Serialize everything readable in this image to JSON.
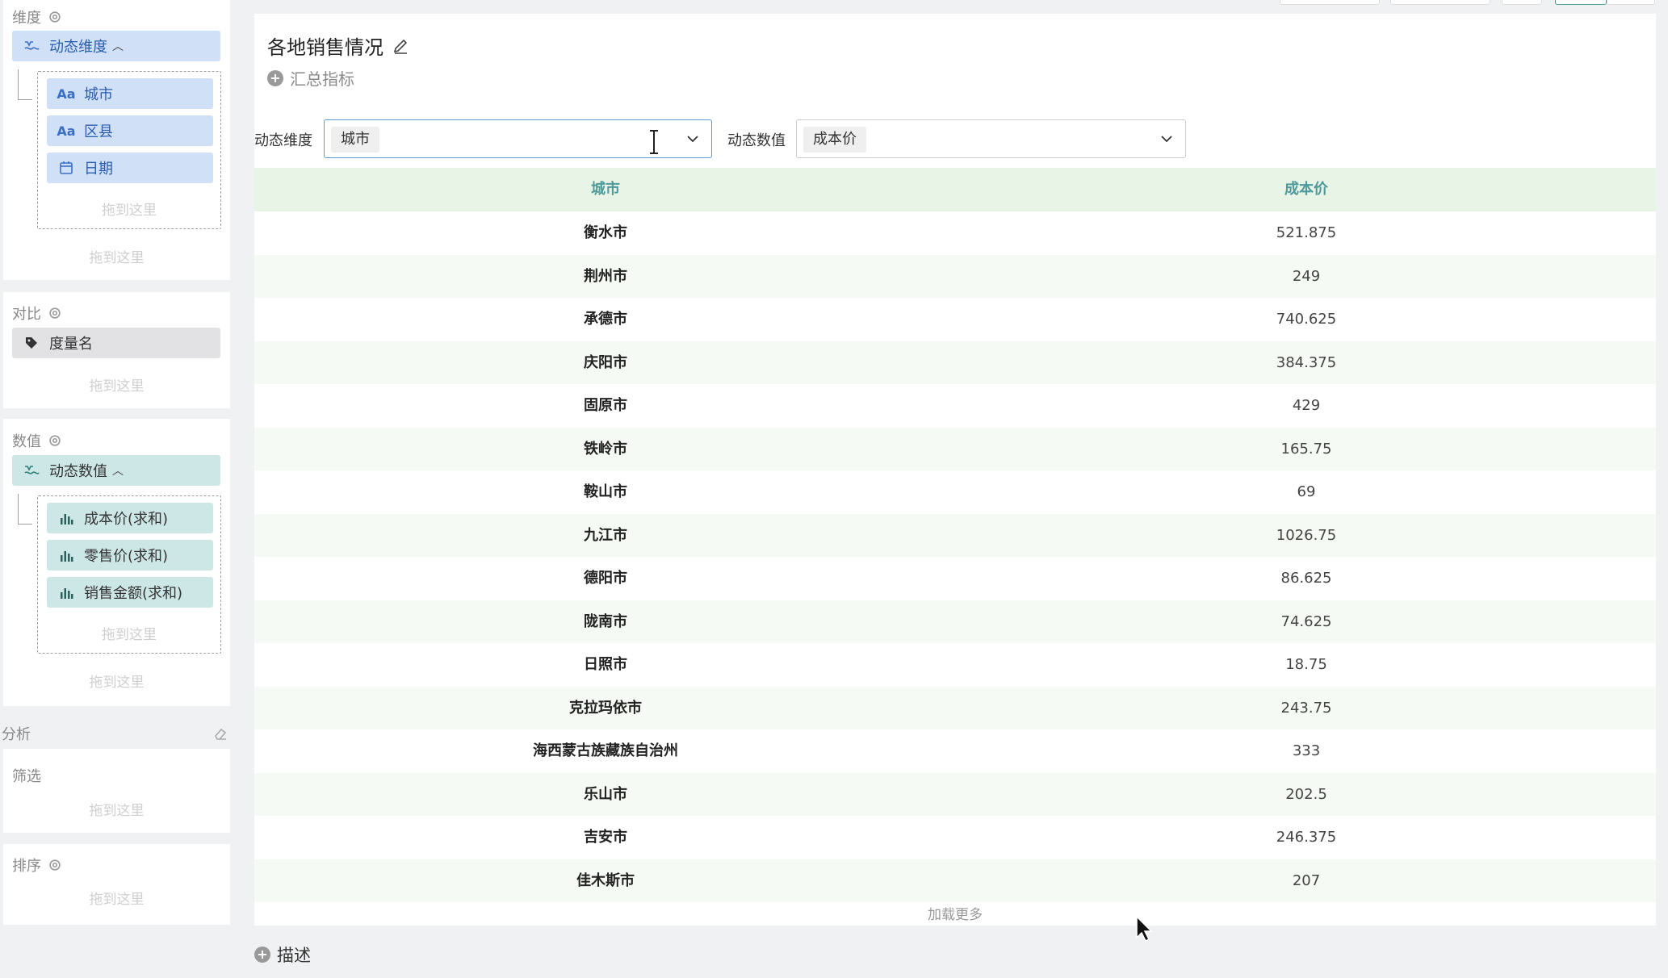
{
  "sidebar": {
    "dimension": {
      "title": "维度",
      "dynamic_label": "动态维度",
      "items": [
        {
          "label": "城市",
          "icon": "text-field-icon"
        },
        {
          "label": "区县",
          "icon": "text-field-icon"
        },
        {
          "label": "日期",
          "icon": "calendar-icon"
        }
      ],
      "drop_inner": "拖到这里",
      "drop_outer": "拖到这里"
    },
    "compare": {
      "title": "对比",
      "item": "度量名",
      "drop": "拖到这里"
    },
    "value": {
      "title": "数值",
      "dynamic_label": "动态数值",
      "items": [
        {
          "label": "成本价(求和)"
        },
        {
          "label": "零售价(求和)"
        },
        {
          "label": "销售金额(求和)"
        }
      ],
      "drop_inner": "拖到这里",
      "drop_outer": "拖到这里"
    },
    "analysis": {
      "title": "分析",
      "filter_title": "筛选",
      "filter_drop": "拖到这里",
      "sort_title": "排序",
      "sort_drop": "拖到这里"
    }
  },
  "main": {
    "title": "各地销售情况",
    "summary_label": "汇总指标",
    "dynamic_dim_label": "动态维度",
    "dynamic_dim_value": "城市",
    "dynamic_val_label": "动态数值",
    "dynamic_val_value": "成本价",
    "table": {
      "columns": [
        "城市",
        "成本价"
      ],
      "rows": [
        [
          "衡水市",
          "521.875"
        ],
        [
          "荆州市",
          "249"
        ],
        [
          "承德市",
          "740.625"
        ],
        [
          "庆阳市",
          "384.375"
        ],
        [
          "固原市",
          "429"
        ],
        [
          "铁岭市",
          "165.75"
        ],
        [
          "鞍山市",
          "69"
        ],
        [
          "九江市",
          "1026.75"
        ],
        [
          "德阳市",
          "86.625"
        ],
        [
          "陇南市",
          "74.625"
        ],
        [
          "日照市",
          "18.75"
        ],
        [
          "克拉玛依市",
          "243.75"
        ],
        [
          "海西蒙古族藏族自治州",
          "333"
        ],
        [
          "乐山市",
          "202.5"
        ],
        [
          "吉安市",
          "246.375"
        ],
        [
          "佳木斯市",
          "207"
        ]
      ]
    },
    "load_more": "加载更多",
    "description_label": "描述"
  },
  "colors": {
    "dimension_pill": "#cfe0f7",
    "measure_pill": "#cde7e6",
    "table_header_bg": "#e8f4e6",
    "table_header_text": "#4f9a9a",
    "active_border": "#5b9bd5"
  }
}
